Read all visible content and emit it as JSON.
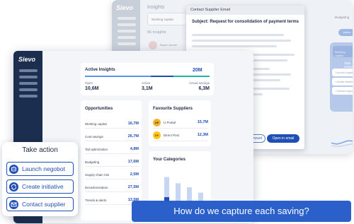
{
  "colors": {
    "primary": "#1f4fb5",
    "sidebar": "#1c2e4f",
    "banner": "#2b5fc9",
    "teal": "#22b3a4",
    "light_blue": "#5b93e6"
  },
  "back_app": {
    "logo": "Sievo",
    "title": "Insights",
    "working_capital_chip": "Working capital",
    "section": "56 Insights",
    "avatar_caption": "Barion Ametti",
    "budgeting_label": "Budgeting",
    "tab_active": "Active",
    "chip_text": "Working capital",
    "take_action_label": "Take action",
    "actions": [
      "Launch negobot",
      "Create initiative",
      "Contact supplier"
    ]
  },
  "modal": {
    "header": "Contact Supplier Email",
    "subject": "Subject: Request for consolidation of payment terms",
    "forward_label": "Forward",
    "open_label": "Open in email"
  },
  "front_app": {
    "logo": "Sievo",
    "active_insights": {
      "title": "Active Insights",
      "total": "20M",
      "stats": [
        {
          "label": "Open",
          "value": "10,6M"
        },
        {
          "label": "Active",
          "value": "3,1M"
        },
        {
          "label": "Actual savings",
          "value": "6,3M"
        }
      ]
    },
    "opportunities": {
      "title": "Opportunities",
      "rows": [
        {
          "name": "Working capital",
          "value": "16,7M"
        },
        {
          "name": "Cost savings",
          "value": "26,7M"
        },
        {
          "name": "Tail optimization",
          "value": "4,8M"
        },
        {
          "name": "Budgeting",
          "value": "17,6M"
        },
        {
          "name": "Supply chain risk",
          "value": "2,5M"
        },
        {
          "name": "Decarbonization",
          "value": "27,5M"
        },
        {
          "name": "Trends & alerts",
          "value": "13,5M"
        }
      ]
    },
    "favourite_suppliers": {
      "title": "Favourite Suppliers",
      "rows": [
        {
          "logo": "UP",
          "name": "U Postal",
          "value": "15,7M"
        },
        {
          "logo": "DP",
          "name": "Direct Post",
          "value": "12,3M"
        }
      ]
    },
    "categories": {
      "title": "Your Categories",
      "stacks": [
        [
          0.45,
          0.28,
          0.15
        ],
        [
          0.4,
          0.22,
          0.12
        ],
        [
          0.35,
          0.2,
          0.1
        ],
        [
          0.28,
          0.16,
          0.09
        ],
        [
          0.25,
          0.14,
          0.08
        ]
      ]
    }
  },
  "take_action": {
    "title": "Take action",
    "buttons": [
      {
        "label": "Launch negobot",
        "icon": "negobot-icon"
      },
      {
        "label": "Create initiative",
        "icon": "initiative-icon"
      },
      {
        "label": "Contact supplier",
        "icon": "mail-icon"
      }
    ]
  },
  "banner": {
    "text": "How do we capture each saving?"
  }
}
